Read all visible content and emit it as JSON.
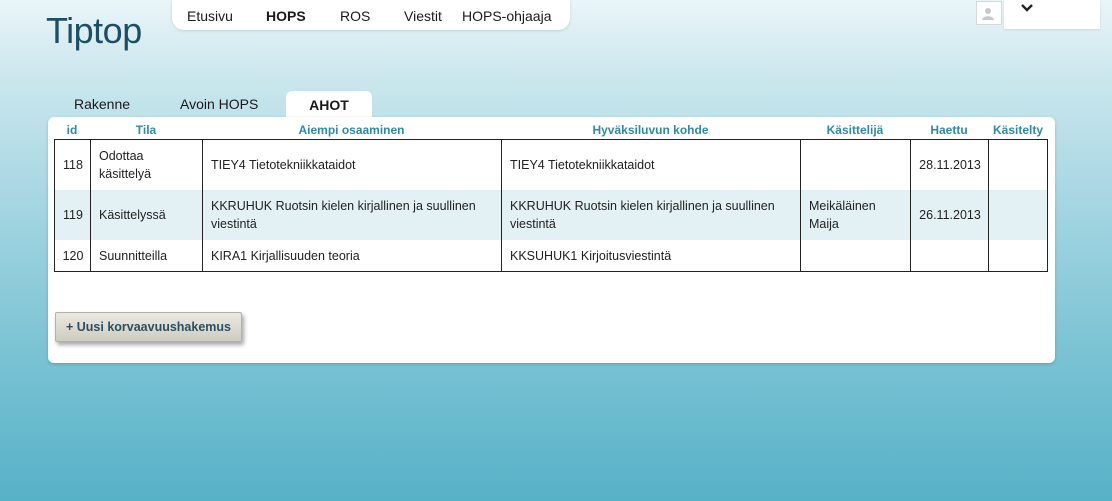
{
  "app": {
    "title": "Tiptop"
  },
  "topnav": {
    "items": [
      {
        "label": "Etusivu",
        "active": false
      },
      {
        "label": "HOPS",
        "active": true
      },
      {
        "label": "ROS",
        "active": false
      },
      {
        "label": "Viestit",
        "active": false
      },
      {
        "label": "HOPS-ohjaaja",
        "active": false
      }
    ]
  },
  "user": {
    "avatar_icon": "user-avatar-icon",
    "menu_icon": "chevron-down-icon"
  },
  "subtabs": {
    "items": [
      {
        "label": "Rakenne",
        "active": false
      },
      {
        "label": "Avoin HOPS",
        "active": false
      },
      {
        "label": "AHOT",
        "active": true
      }
    ]
  },
  "table": {
    "headers": [
      "id",
      "Tila",
      "Aiempi osaaminen",
      "Hyväksiluvun kohde",
      "Käsittelijä",
      "Haettu",
      "Käsitelty"
    ],
    "rows": [
      {
        "id": "118",
        "tila": "Odottaa käsittelyä",
        "aiempi": "TIEY4 Tietotekniikkataidot",
        "kohde": "TIEY4 Tietotekniikkataidot",
        "kasittelija": "",
        "haettu": "28.11.2013",
        "kasitelty": ""
      },
      {
        "id": "119",
        "tila": "Käsittelyssä",
        "aiempi": "KKRUHUK Ruotsin kielen kirjallinen ja suullinen viestintä",
        "kohde": "KKRUHUK Ruotsin kielen kirjallinen ja suullinen viestintä",
        "kasittelija": "Meikäläinen Maija",
        "haettu": "26.11.2013",
        "kasitelty": ""
      },
      {
        "id": "120",
        "tila": "Suunnitteilla",
        "aiempi": "KIRA1 Kirjallisuuden teoria",
        "kohde": "KKSUHUK1 Kirjoitusviestintä",
        "kasittelija": "",
        "haettu": "",
        "kasitelty": ""
      }
    ]
  },
  "actions": {
    "add_label": "+ Uusi korvaavuushakemus"
  },
  "colors": {
    "header_text": "#2f8aa6",
    "logo": "#1d4e63",
    "alt_row": "#e3f1f5"
  }
}
